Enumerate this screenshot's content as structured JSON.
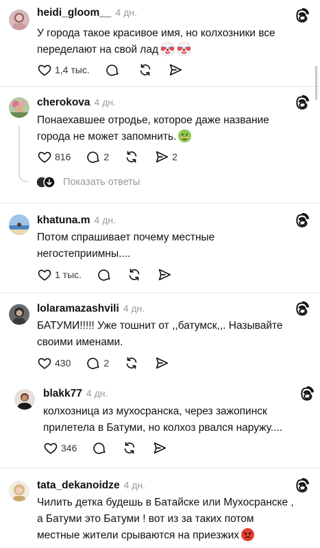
{
  "comments": [
    {
      "username": "heidi_gloom__",
      "time": "4 дн.",
      "text_lines": [
        "У города такое красивое имя, но колхозники все",
        "переделают на свой лад"
      ],
      "emoji": [
        "clown-face-emoji",
        "clown-face-emoji"
      ],
      "likes": "1,4 тыс.",
      "replies": "",
      "shares": ""
    },
    {
      "username": "cherokova",
      "time": "4 дн.",
      "text_lines": [
        "Понаехавшее отродье, которое даже название",
        "города не может запомнить."
      ],
      "emoji": [
        "nauseated-face-emoji"
      ],
      "likes": "816",
      "replies": "2",
      "shares": "2",
      "show_replies": "Показать ответы"
    },
    {
      "username": "khatuna.m",
      "time": "4 дн.",
      "text_lines": [
        "Потом спрашивает почему местные",
        "негостеприимны...."
      ],
      "likes": "1 тыс.",
      "replies": "",
      "shares": ""
    },
    {
      "username": "lolaramazashvili",
      "time": "4 дн.",
      "text_lines": [
        "БАТУМИ!!!!! Уже тошнит от ,,батумск,,. Называйте",
        "своими именами."
      ],
      "likes": "430",
      "replies": "2",
      "shares": ""
    },
    {
      "username": "blakk77",
      "time": "4 дн.",
      "text_lines": [
        "колхозница из мухосранска, через зажопинск",
        "прилетела в Батуми, но колхоз рвался наружу...."
      ],
      "likes": "346",
      "replies": "",
      "shares": ""
    },
    {
      "username": "tata_dekanoidze",
      "time": "4 дн.",
      "text_lines": [
        "Чилить детка будешь в Батайске или Мухосранске ,",
        "а  Батуми это Батуми ! вот из за таких потом",
        "местные жители срываются на приезжих"
      ],
      "emoji": [
        "angry-face-emoji"
      ],
      "likes": "",
      "replies": "",
      "shares": ""
    }
  ],
  "icons": {
    "like": "heart-icon",
    "reply": "comment-bubble-icon",
    "repost": "repost-icon",
    "share": "share-send-icon",
    "threads": "threads-logo-icon"
  },
  "colors": {
    "text": "#111111",
    "muted": "#999999",
    "divider": "#e6e6e6"
  }
}
